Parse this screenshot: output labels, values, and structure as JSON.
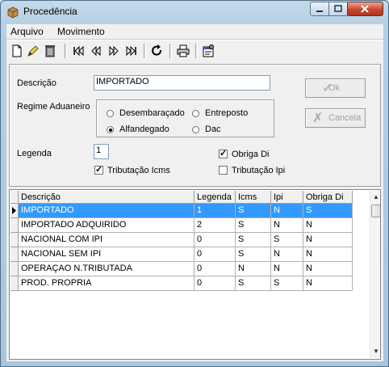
{
  "window": {
    "title": "Procedência"
  },
  "menu": {
    "items": [
      {
        "label": "Arquivo"
      },
      {
        "label": "Movimento"
      }
    ]
  },
  "toolbar": {
    "icons": [
      "new-document-icon",
      "edit-icon",
      "delete-icon",
      "first-record-icon",
      "prior-record-icon",
      "next-record-icon",
      "last-record-icon",
      "refresh-icon",
      "print-icon",
      "properties-icon"
    ]
  },
  "form": {
    "descricao_label": "Descrição",
    "descricao_value": "IMPORTADO",
    "regime_label": "Regime Aduaneiro",
    "regime_options": [
      "Desembaraçado",
      "Entreposto",
      "Alfandegado",
      "Dac"
    ],
    "regime_selected": "Alfandegado",
    "legenda_label": "Legenda",
    "legenda_value": "1",
    "obriga_di_label": "Obriga Di",
    "obriga_di_checked": true,
    "trib_icms_label": "Tributação Icms",
    "trib_icms_checked": true,
    "trib_ipi_label": "Tributação Ipi",
    "trib_ipi_checked": false,
    "ok_label": "Ok",
    "cancela_label": "Cancela"
  },
  "grid": {
    "columns": [
      "Descrição",
      "Legenda",
      "Icms",
      "Ipi",
      "Obriga Di"
    ],
    "rows": [
      [
        "IMPORTADO",
        "1",
        "S",
        "N",
        "S"
      ],
      [
        "IMPORTADO ADQUIRIDO",
        "2",
        "S",
        "N",
        "N"
      ],
      [
        "NACIONAL COM IPI",
        "0",
        "S",
        "S",
        "N"
      ],
      [
        "NACIONAL SEM IPI",
        "0",
        "S",
        "N",
        "N"
      ],
      [
        "OPERAÇAO N.TRIBUTADA",
        "0",
        "N",
        "N",
        "N"
      ],
      [
        "PROD. PROPRIA",
        "0",
        "S",
        "S",
        "N"
      ]
    ],
    "selected_row": 0
  },
  "colors": {
    "selection": "#3399ff",
    "titlebar": "#b5cfe3",
    "close_button": "#c9462c"
  }
}
